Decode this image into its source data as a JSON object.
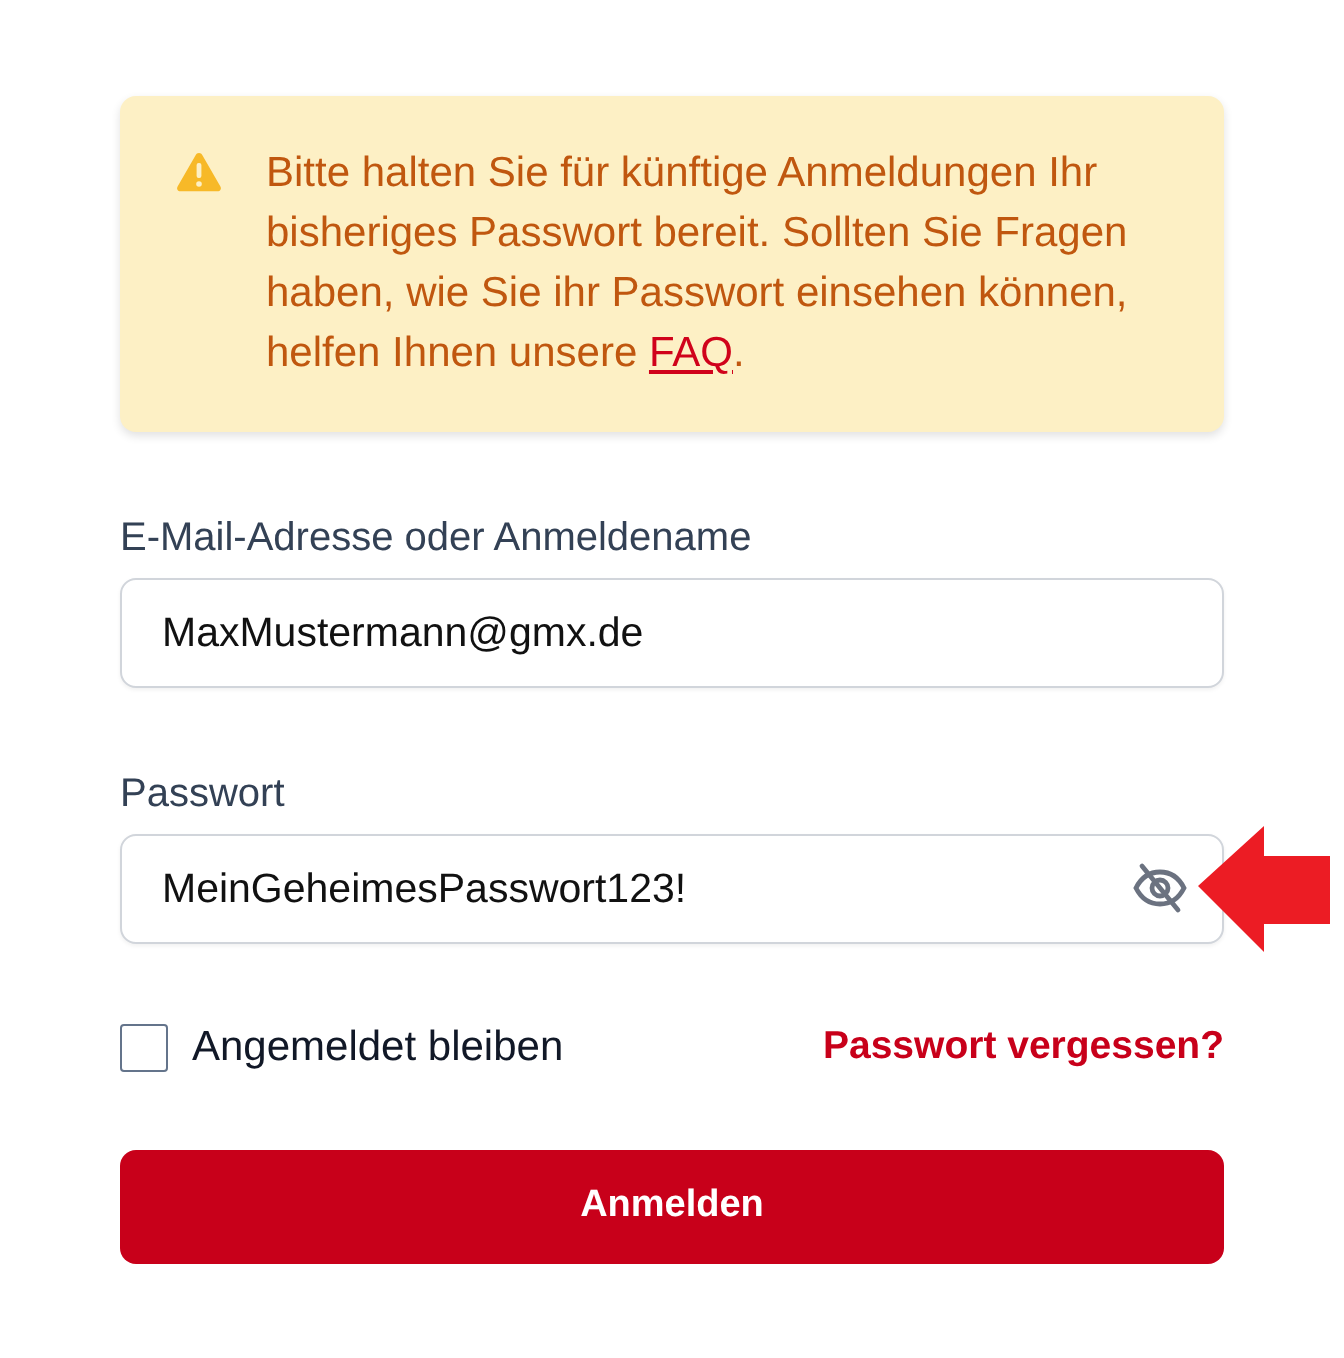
{
  "notice": {
    "text": "Bitte halten Sie für künftige Anmeldungen Ihr bisheriges Passwort bereit. Sollten Sie Fragen haben, wie Sie ihr Passwort einsehen können, helfen Ihnen unsere ",
    "link": "FAQ",
    "suffix": "."
  },
  "fields": [
    {
      "kind": "text",
      "label": "E-Mail-Adresse oder Anmeldename",
      "value": "MaxMustermann@gmx.de"
    },
    {
      "kind": "password",
      "label": "Passwort",
      "value": "MeinGeheimesPasswort123!",
      "revealed": true
    }
  ],
  "remember": {
    "label": "Angemeldet bleiben",
    "checked": false
  },
  "forgot_link": "Passwort vergessen?",
  "submit": "Anmelden"
}
